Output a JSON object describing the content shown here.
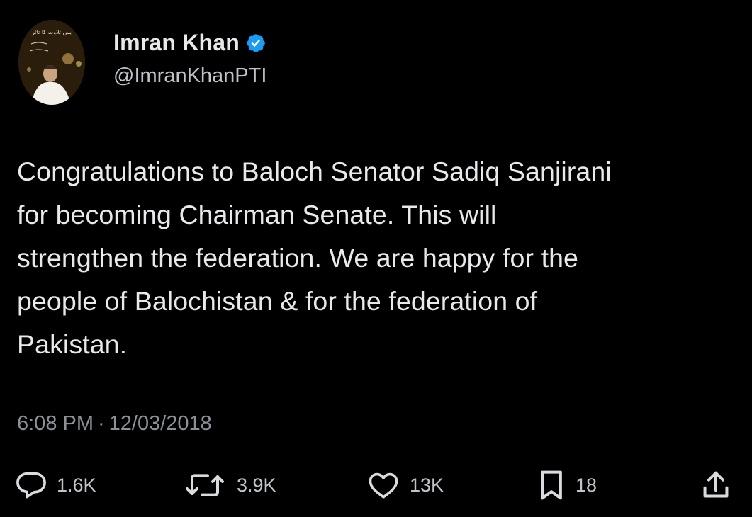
{
  "author": {
    "display_name": "Imran Khan",
    "handle": "@ImranKhanPTI",
    "verified": true,
    "avatar_text": "بس تلاوت کا تاثر"
  },
  "tweet": {
    "text_lines": [
      "Congratulations to Baloch Senator Sadiq Sanjirani",
      "for becoming Chairman Senate. This will",
      "strengthen the federation. We are happy for the",
      "people of Balochistan & for the federation of",
      "Pakistan."
    ],
    "time": "6:08 PM",
    "separator": "·",
    "date": "12/03/2018"
  },
  "actions": {
    "reply": {
      "icon": "reply-icon",
      "count": "1.6K"
    },
    "retweet": {
      "icon": "retweet-icon",
      "count": "3.9K"
    },
    "like": {
      "icon": "heart-icon",
      "count": "13K"
    },
    "bookmark": {
      "icon": "bookmark-icon",
      "count": "18"
    },
    "share": {
      "icon": "share-icon"
    }
  },
  "colors": {
    "background": "#000000",
    "text": "#e7e9ea",
    "secondary_text": "#8b9197",
    "verified_blue": "#1d9bf0"
  }
}
